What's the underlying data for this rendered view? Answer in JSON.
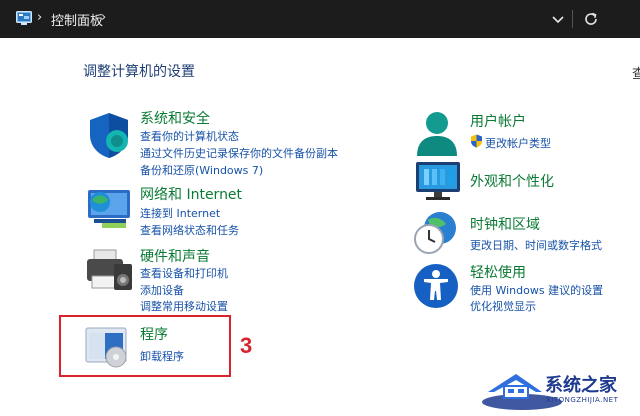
{
  "address_bar": {
    "path": "控制面板"
  },
  "page_title": "调整计算机的设置",
  "cutoff_char": "查",
  "categories": {
    "system": {
      "title": "系统和安全",
      "links": [
        "查看你的计算机状态",
        "通过文件历史记录保存你的文件备份副本",
        "备份和还原(Windows 7)"
      ]
    },
    "network": {
      "title": "网络和 Internet",
      "links": [
        "连接到 Internet",
        "查看网络状态和任务"
      ]
    },
    "hardware": {
      "title": "硬件和声音",
      "links": [
        "查看设备和打印机",
        "添加设备",
        "调整常用移动设置"
      ]
    },
    "programs": {
      "title": "程序",
      "links": [
        "卸载程序"
      ]
    },
    "accounts": {
      "title": "用户帐户",
      "links": [
        "更改帐户类型"
      ]
    },
    "appearance": {
      "title": "外观和个性化",
      "links": []
    },
    "clock": {
      "title": "时钟和区域",
      "links": [
        "更改日期、时间或数字格式"
      ]
    },
    "ease": {
      "title": "轻松使用",
      "links": [
        "使用 Windows 建议的设置",
        "优化视觉显示"
      ]
    }
  },
  "annotation": {
    "step_number": "3",
    "color": "#d9242e"
  },
  "watermark": {
    "text": "系统之家",
    "sub": "XITONGZHIJIA.NET"
  },
  "colors": {
    "category_title": "#0a7a34",
    "link": "#1752a8",
    "page_title": "#1f3f73",
    "address_bar_bg": "#1c1c1c"
  }
}
